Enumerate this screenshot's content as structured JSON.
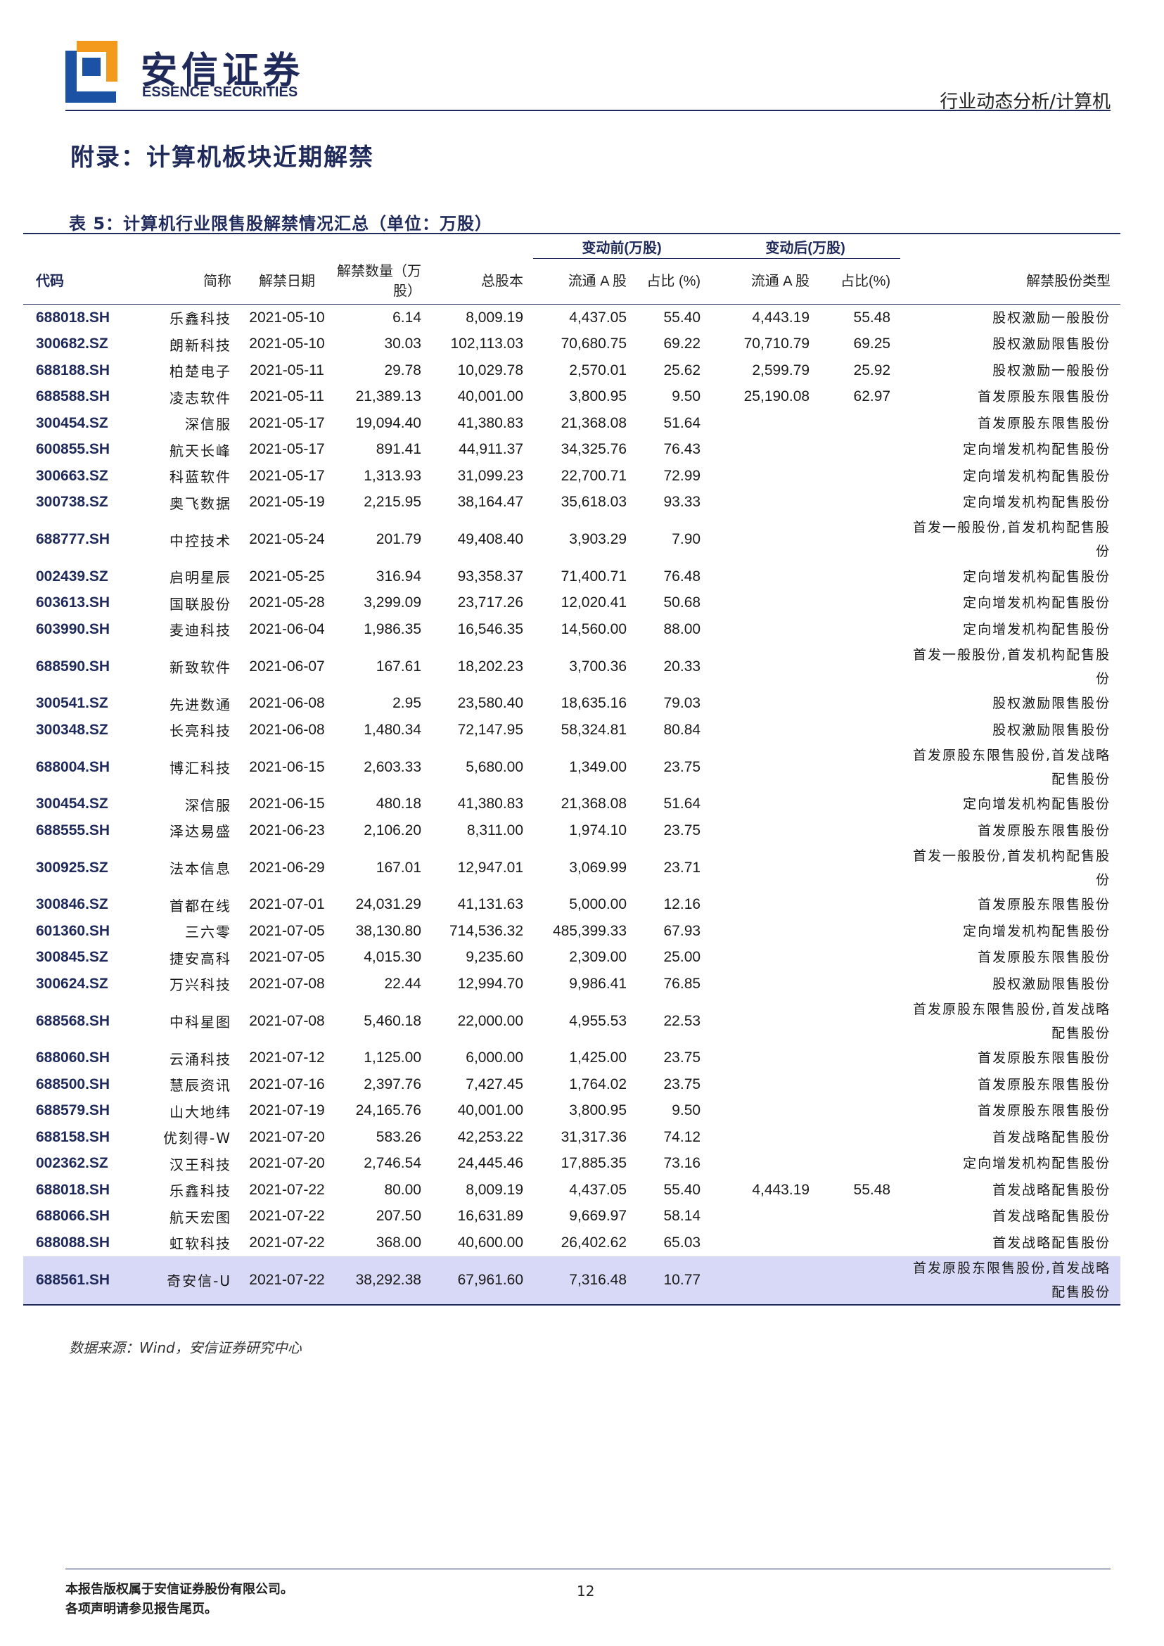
{
  "header": {
    "brand_cn": "安信证券",
    "brand_en": "ESSENCE SECURITIES",
    "report_category": "行业动态分析/计算机",
    "colors": {
      "brand_dark": "#1f2a5a",
      "brand_orange": "#f39a1c",
      "brand_blue": "#1c52a3"
    }
  },
  "section_title": "附录：计算机板块近期解禁",
  "table_title": "表 5：计算机行业限售股解禁情况汇总（单位：万股）",
  "table": {
    "group_before": "变动前(万股)",
    "group_after": "变动后(万股)",
    "columns": [
      "代码",
      "简称",
      "解禁日期",
      "解禁数量（万股）",
      "总股本",
      "流通 A 股",
      "占比 (%)",
      "流通 A 股",
      "占比(%)",
      "解禁股份类型"
    ],
    "rows": [
      [
        "688018.SH",
        "乐鑫科技",
        "2021-05-10",
        "6.14",
        "8,009.19",
        "4,437.05",
        "55.40",
        "4,443.19",
        "55.48",
        "股权激励一般股份"
      ],
      [
        "300682.SZ",
        "朗新科技",
        "2021-05-10",
        "30.03",
        "102,113.03",
        "70,680.75",
        "69.22",
        "70,710.79",
        "69.25",
        "股权激励限售股份"
      ],
      [
        "688188.SH",
        "柏楚电子",
        "2021-05-11",
        "29.78",
        "10,029.78",
        "2,570.01",
        "25.62",
        "2,599.79",
        "25.92",
        "股权激励一般股份"
      ],
      [
        "688588.SH",
        "凌志软件",
        "2021-05-11",
        "21,389.13",
        "40,001.00",
        "3,800.95",
        "9.50",
        "25,190.08",
        "62.97",
        "首发原股东限售股份"
      ],
      [
        "300454.SZ",
        "深信服",
        "2021-05-17",
        "19,094.40",
        "41,380.83",
        "21,368.08",
        "51.64",
        "",
        "",
        "首发原股东限售股份"
      ],
      [
        "600855.SH",
        "航天长峰",
        "2021-05-17",
        "891.41",
        "44,911.37",
        "34,325.76",
        "76.43",
        "",
        "",
        "定向增发机构配售股份"
      ],
      [
        "300663.SZ",
        "科蓝软件",
        "2021-05-17",
        "1,313.93",
        "31,099.23",
        "22,700.71",
        "72.99",
        "",
        "",
        "定向增发机构配售股份"
      ],
      [
        "300738.SZ",
        "奥飞数据",
        "2021-05-19",
        "2,215.95",
        "38,164.47",
        "35,618.03",
        "93.33",
        "",
        "",
        "定向增发机构配售股份"
      ],
      [
        "688777.SH",
        "中控技术",
        "2021-05-24",
        "201.79",
        "49,408.40",
        "3,903.29",
        "7.90",
        "",
        "",
        "首发一般股份,首发机构配售股份"
      ],
      [
        "002439.SZ",
        "启明星辰",
        "2021-05-25",
        "316.94",
        "93,358.37",
        "71,400.71",
        "76.48",
        "",
        "",
        "定向增发机构配售股份"
      ],
      [
        "603613.SH",
        "国联股份",
        "2021-05-28",
        "3,299.09",
        "23,717.26",
        "12,020.41",
        "50.68",
        "",
        "",
        "定向增发机构配售股份"
      ],
      [
        "603990.SH",
        "麦迪科技",
        "2021-06-04",
        "1,986.35",
        "16,546.35",
        "14,560.00",
        "88.00",
        "",
        "",
        "定向增发机构配售股份"
      ],
      [
        "688590.SH",
        "新致软件",
        "2021-06-07",
        "167.61",
        "18,202.23",
        "3,700.36",
        "20.33",
        "",
        "",
        "首发一般股份,首发机构配售股份"
      ],
      [
        "300541.SZ",
        "先进数通",
        "2021-06-08",
        "2.95",
        "23,580.40",
        "18,635.16",
        "79.03",
        "",
        "",
        "股权激励限售股份"
      ],
      [
        "300348.SZ",
        "长亮科技",
        "2021-06-08",
        "1,480.34",
        "72,147.95",
        "58,324.81",
        "80.84",
        "",
        "",
        "股权激励限售股份"
      ],
      [
        "688004.SH",
        "博汇科技",
        "2021-06-15",
        "2,603.33",
        "5,680.00",
        "1,349.00",
        "23.75",
        "",
        "",
        "首发原股东限售股份,首发战略配售股份"
      ],
      [
        "300454.SZ",
        "深信服",
        "2021-06-15",
        "480.18",
        "41,380.83",
        "21,368.08",
        "51.64",
        "",
        "",
        "定向增发机构配售股份"
      ],
      [
        "688555.SH",
        "泽达易盛",
        "2021-06-23",
        "2,106.20",
        "8,311.00",
        "1,974.10",
        "23.75",
        "",
        "",
        "首发原股东限售股份"
      ],
      [
        "300925.SZ",
        "法本信息",
        "2021-06-29",
        "167.01",
        "12,947.01",
        "3,069.99",
        "23.71",
        "",
        "",
        "首发一般股份,首发机构配售股份"
      ],
      [
        "300846.SZ",
        "首都在线",
        "2021-07-01",
        "24,031.29",
        "41,131.63",
        "5,000.00",
        "12.16",
        "",
        "",
        "首发原股东限售股份"
      ],
      [
        "601360.SH",
        "三六零",
        "2021-07-05",
        "38,130.80",
        "714,536.32",
        "485,399.33",
        "67.93",
        "",
        "",
        "定向增发机构配售股份"
      ],
      [
        "300845.SZ",
        "捷安高科",
        "2021-07-05",
        "4,015.30",
        "9,235.60",
        "2,309.00",
        "25.00",
        "",
        "",
        "首发原股东限售股份"
      ],
      [
        "300624.SZ",
        "万兴科技",
        "2021-07-08",
        "22.44",
        "12,994.70",
        "9,986.41",
        "76.85",
        "",
        "",
        "股权激励限售股份"
      ],
      [
        "688568.SH",
        "中科星图",
        "2021-07-08",
        "5,460.18",
        "22,000.00",
        "4,955.53",
        "22.53",
        "",
        "",
        "首发原股东限售股份,首发战略配售股份"
      ],
      [
        "688060.SH",
        "云涌科技",
        "2021-07-12",
        "1,125.00",
        "6,000.00",
        "1,425.00",
        "23.75",
        "",
        "",
        "首发原股东限售股份"
      ],
      [
        "688500.SH",
        "慧辰资讯",
        "2021-07-16",
        "2,397.76",
        "7,427.45",
        "1,764.02",
        "23.75",
        "",
        "",
        "首发原股东限售股份"
      ],
      [
        "688579.SH",
        "山大地纬",
        "2021-07-19",
        "24,165.76",
        "40,001.00",
        "3,800.95",
        "9.50",
        "",
        "",
        "首发原股东限售股份"
      ],
      [
        "688158.SH",
        "优刻得-W",
        "2021-07-20",
        "583.26",
        "42,253.22",
        "31,317.36",
        "74.12",
        "",
        "",
        "首发战略配售股份"
      ],
      [
        "002362.SZ",
        "汉王科技",
        "2021-07-20",
        "2,746.54",
        "24,445.46",
        "17,885.35",
        "73.16",
        "",
        "",
        "定向增发机构配售股份"
      ],
      [
        "688018.SH",
        "乐鑫科技",
        "2021-07-22",
        "80.00",
        "8,009.19",
        "4,437.05",
        "55.40",
        "4,443.19",
        "55.48",
        "首发战略配售股份"
      ],
      [
        "688066.SH",
        "航天宏图",
        "2021-07-22",
        "207.50",
        "16,631.89",
        "9,669.97",
        "58.14",
        "",
        "",
        "首发战略配售股份"
      ],
      [
        "688088.SH",
        "虹软科技",
        "2021-07-22",
        "368.00",
        "40,600.00",
        "26,402.62",
        "65.03",
        "",
        "",
        "首发战略配售股份"
      ],
      [
        "688561.SH",
        "奇安信-U",
        "2021-07-22",
        "38,292.38",
        "67,961.60",
        "7,316.48",
        "10.77",
        "",
        "",
        "首发原股东限售股份,首发战略配售股份"
      ]
    ]
  },
  "source_note": "数据来源：Wind，安信证券研究中心",
  "footer": {
    "line1": "本报告版权属于安信证券股份有限公司。",
    "line2": "各项声明请参见报告尾页。",
    "page_number": "12"
  }
}
